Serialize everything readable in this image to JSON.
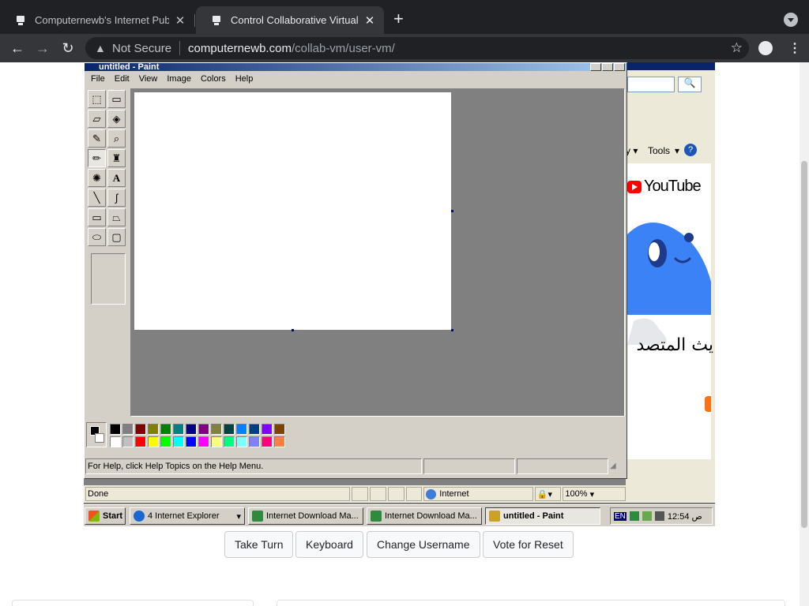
{
  "browser": {
    "tabs": [
      {
        "title": "Computernewb's Internet Pub"
      },
      {
        "title": "Control Collaborative Virtual M"
      }
    ],
    "address": {
      "security": "Not Secure",
      "host": "computernewb.com",
      "path": "/collab-vm/user-vm/"
    }
  },
  "vm": {
    "paint": {
      "title": "untitled - Paint",
      "menu": [
        "File",
        "Edit",
        "View",
        "Image",
        "Colors",
        "Help"
      ],
      "status_help": "For Help, click Help Topics on the Help Menu.",
      "palette_top": [
        "#000000",
        "#808080",
        "#800000",
        "#808000",
        "#008000",
        "#008080",
        "#000080",
        "#800080",
        "#808040",
        "#004040",
        "#0080ff",
        "#004080",
        "#8000ff",
        "#804000"
      ],
      "palette_bottom": [
        "#ffffff",
        "#c0c0c0",
        "#ff0000",
        "#ffff00",
        "#00ff00",
        "#00ffff",
        "#0000ff",
        "#ff00ff",
        "#ffff80",
        "#00ff80",
        "#80ffff",
        "#8080ff",
        "#ff0080",
        "#ff8040"
      ]
    },
    "ie": {
      "tools_label": "Tools",
      "youtube_label": "YouTube",
      "arabic_text": "يث المتصد",
      "status_done": "Done",
      "zone": "Internet",
      "zoom": "100%"
    },
    "taskbar": {
      "start": "Start",
      "items": [
        "4 Internet Explorer",
        "Internet Download Ma...",
        "Internet Download Ma...",
        "untitled - Paint"
      ],
      "lang": "EN",
      "clock": "12:54 ص"
    }
  },
  "controls": {
    "take_turn": "Take Turn",
    "keyboard": "Keyboard",
    "change_username": "Change Username",
    "vote_reset": "Vote for Reset"
  }
}
